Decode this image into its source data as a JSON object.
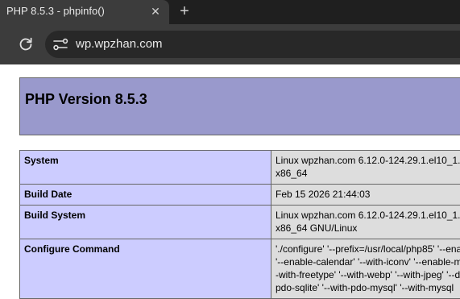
{
  "browser": {
    "tab_title": "PHP 8.5.3 - phpinfo()",
    "tab_close_glyph": "✕",
    "new_tab_glyph": "+",
    "url": "wp.wpzhan.com"
  },
  "phpinfo": {
    "title": "PHP Version 8.5.3",
    "rows": [
      {
        "label": "System",
        "lines": [
          "Linux wpzhan.com 6.12.0-124.29.1.el10_1.",
          "x86_64"
        ]
      },
      {
        "label": "Build Date",
        "lines": [
          "Feb 15 2026 21:44:03"
        ]
      },
      {
        "label": "Build System",
        "lines": [
          "Linux wpzhan.com 6.12.0-124.29.1.el10_1.",
          "x86_64 GNU/Linux"
        ]
      },
      {
        "label": "Configure Command",
        "lines": [
          "'./configure' '--prefix=/usr/local/php85' '--ena",
          "'--enable-calendar' '--with-iconv' '--enable-m",
          "-with-freetype' '--with-webp' '--with-jpeg' '--d",
          "pdo-sqlite' '--with-pdo-mysql' '--with-mysql"
        ]
      }
    ]
  },
  "colors": {
    "header_bg": "#9999cc",
    "label_bg": "#ccccff",
    "value_bg": "#dddddd",
    "chrome_dark": "#1f1f1f",
    "chrome_toolbar": "#3c3c3c"
  }
}
